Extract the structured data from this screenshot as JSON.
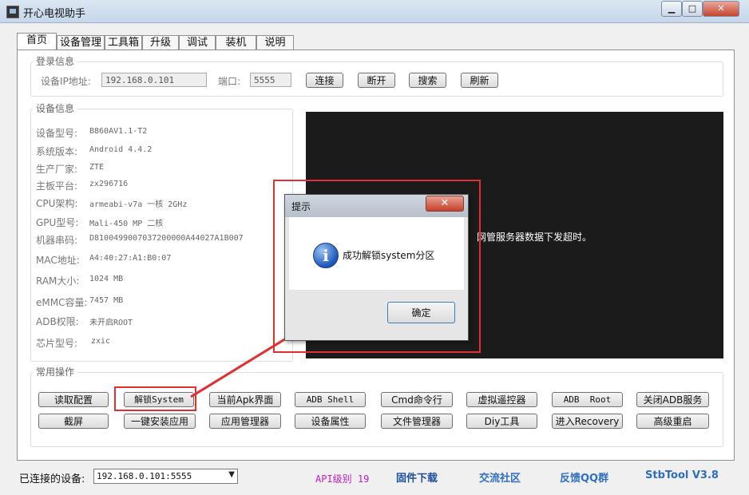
{
  "window": {
    "title": "开心电视助手",
    "min_label": "▁",
    "max_label": "□",
    "close_label": "✕"
  },
  "tabs": [
    "首页",
    "设备管理",
    "工具箱",
    "升级",
    "调试",
    "装机",
    "说明"
  ],
  "login": {
    "group_title": "登录信息",
    "ip_label": "设备IP地址:",
    "ip_value": "192.168.0.101",
    "port_label": "端口:",
    "port_value": "5555",
    "buttons": [
      "连接",
      "断开",
      "搜索",
      "刷新"
    ]
  },
  "device": {
    "group_title": "设备信息",
    "rows": [
      {
        "label": "设备型号:",
        "value": "B860AV1.1-T2"
      },
      {
        "label": "系统版本:",
        "value": "Android 4.4.2"
      },
      {
        "label": "生产厂家:",
        "value": "ZTE"
      },
      {
        "label": "主板平台:",
        "value": "zx296716"
      },
      {
        "label": "CPU架构:",
        "value": "armeabi-v7a 一核 2GHz"
      },
      {
        "label": "GPU型号:",
        "value": "Mali-450 MP 二核"
      },
      {
        "label": "机器串码:",
        "value": "D8100499007037200000A44027A1B007"
      },
      {
        "label": "MAC地址:",
        "value": "A4:40:27:A1:B0:07"
      },
      {
        "label": "RAM大小:",
        "value": "1024 MB"
      },
      {
        "label": "eMMC容量:",
        "value": "7457 MB"
      },
      {
        "label": "ADB权限:",
        "value": "未开启ROOT"
      },
      {
        "label": "芯片型号:",
        "value": "zxic"
      }
    ]
  },
  "screen_message": "网管服务器数据下发超时。",
  "dialog": {
    "title": "提示",
    "close_label": "✕",
    "icon": "info-icon",
    "icon_glyph": "i",
    "message": "成功解锁system分区",
    "ok_label": "确定"
  },
  "ops": {
    "group_title": "常用操作",
    "row1": [
      "读取配置",
      "解锁System",
      "当前Apk界面",
      "ADB Shell",
      "Cmd命令行",
      "虚拟遥控器",
      "ADB  Root",
      "关闭ADB服务"
    ],
    "row2": [
      "截屏",
      "一键安装应用",
      "应用管理器",
      "设备属性",
      "文件管理器",
      "Diy工具",
      "进入Recovery",
      "高级重启"
    ]
  },
  "status": {
    "connected_label": "已连接的设备:",
    "connected_value": "192.168.0.101:5555",
    "api_level": "API级别 19",
    "links": [
      "固件下载",
      "交流社区",
      "反馈QQ群",
      "StbTool V3.8"
    ]
  },
  "colors": {
    "highlight_red": "#e03030",
    "link_blue": "#2f6fbf",
    "api_purple": "#c020c0"
  }
}
